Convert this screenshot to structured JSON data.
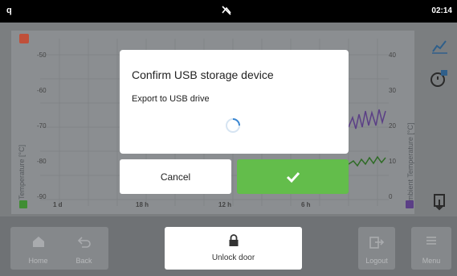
{
  "statusbar": {
    "indicator": "q",
    "time": "02:14"
  },
  "chart": {
    "left_ticks": [
      "-50",
      "-60",
      "-70",
      "-80",
      "-90"
    ],
    "right_ticks": [
      "40",
      "30",
      "20",
      "10",
      "0"
    ],
    "x_ticks": [
      "1 d",
      "18 h",
      "12 h",
      "6 h"
    ],
    "left_axis_title": "Temperature [°C]",
    "right_axis_title": "Ambient Temperature [°C]"
  },
  "dialog": {
    "title": "Confirm USB storage device",
    "message": "Export to USB drive",
    "cancel_label": "Cancel"
  },
  "nav": {
    "home": "Home",
    "back": "Back",
    "unlock": "Unlock door",
    "logout": "Logout",
    "menu": "Menu"
  },
  "colors": {
    "confirm": "#63bd4b",
    "series_purple": "#5b3f86",
    "series_green": "#2e6b25"
  }
}
